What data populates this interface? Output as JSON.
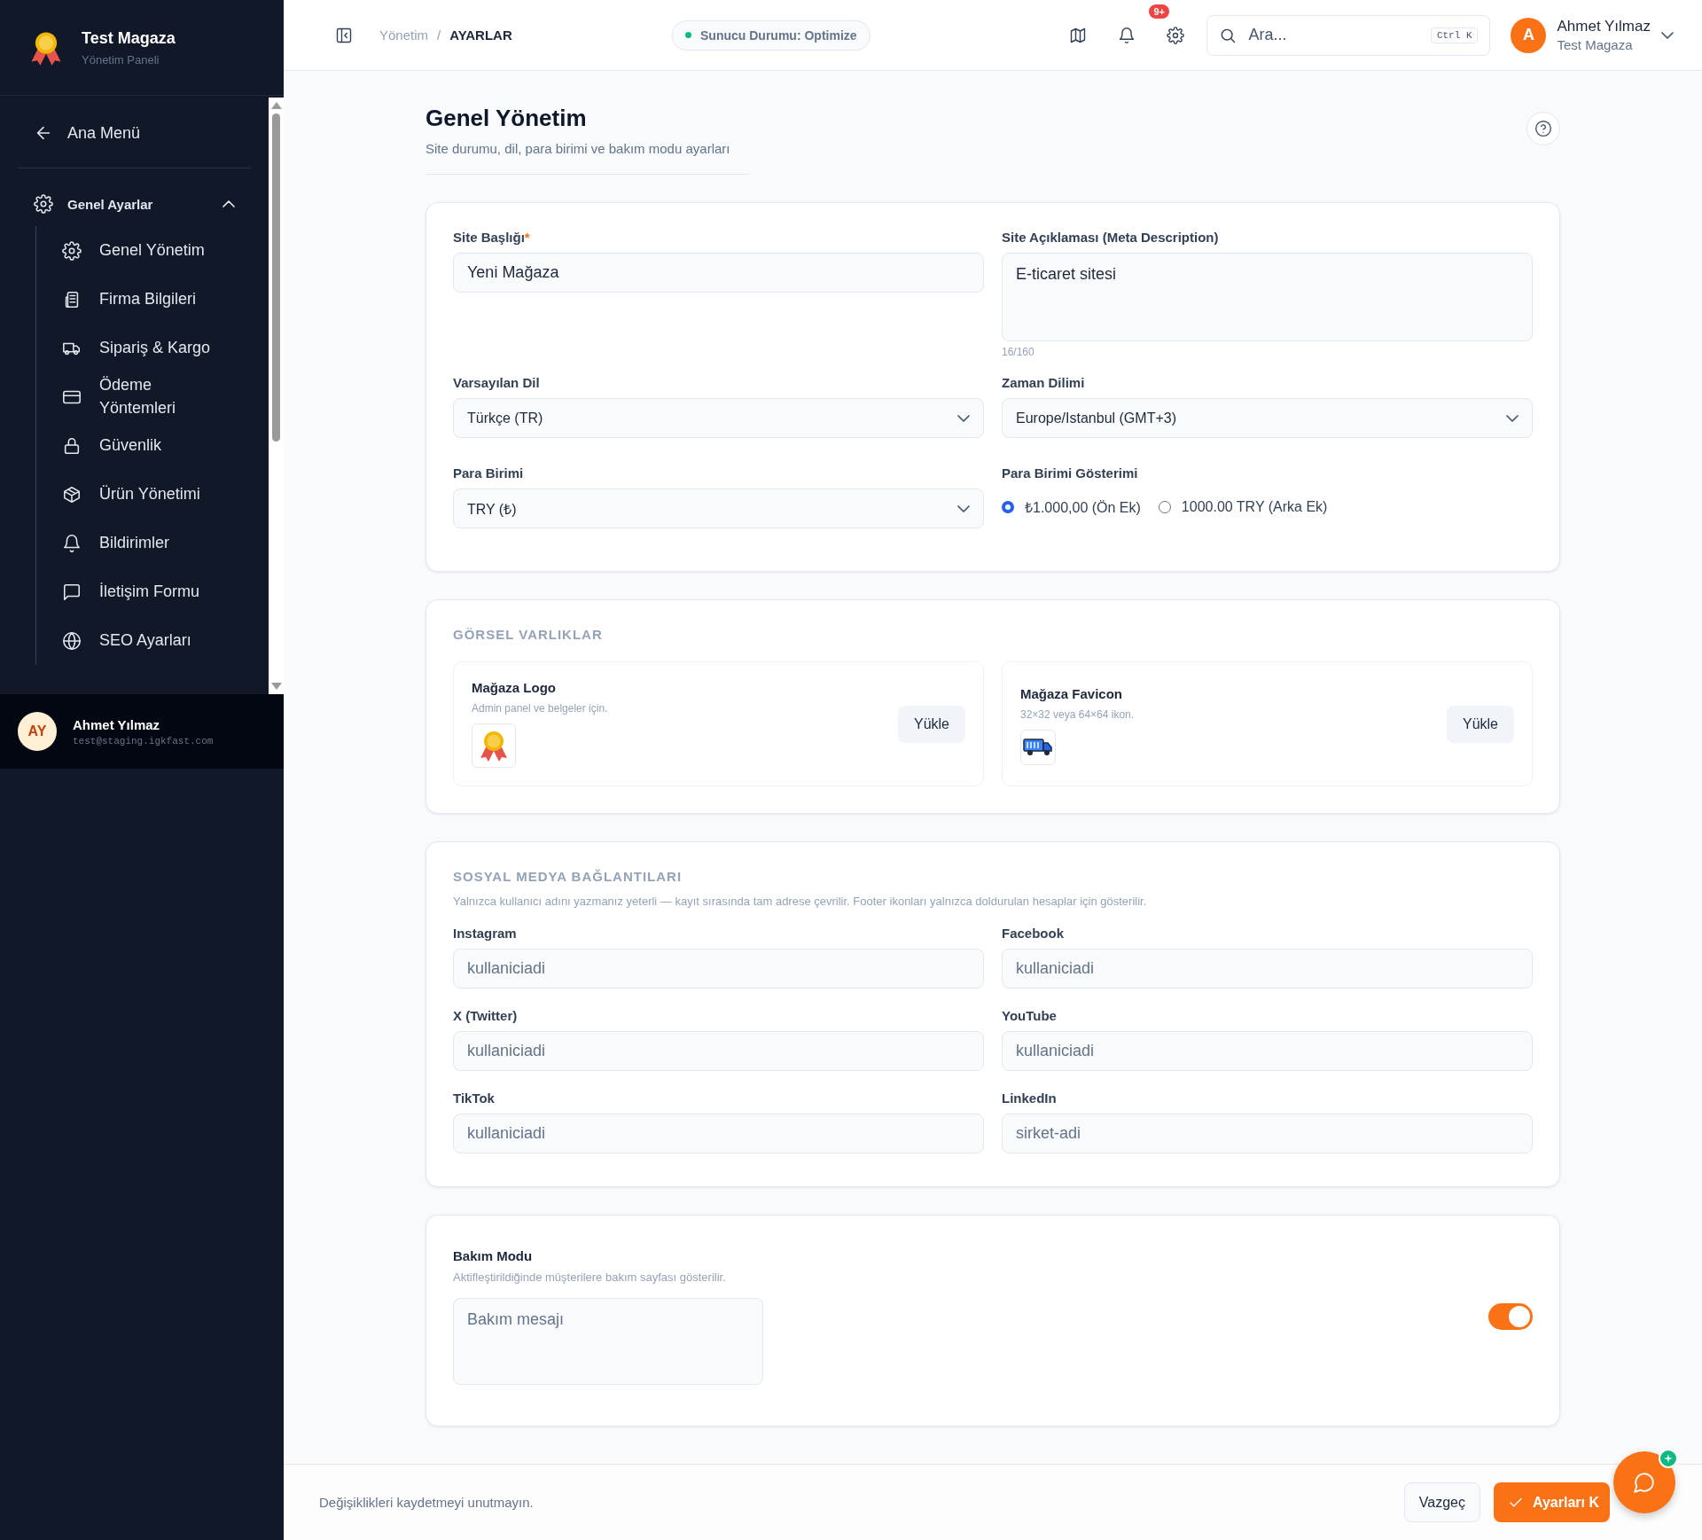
{
  "sidebar": {
    "brand": {
      "title": "Test Magaza",
      "subtitle": "Yönetim Paneli"
    },
    "back_link": "Ana Menü",
    "group": {
      "label": "Genel Ayarlar",
      "expanded": true,
      "children": [
        {
          "label": "Genel Yönetim",
          "selected": false
        },
        {
          "label": "Firma Bilgileri",
          "selected": false
        },
        {
          "label": "Sipariş & Kargo",
          "selected": false
        },
        {
          "label": "Ödeme Yöntemleri",
          "selected": false
        },
        {
          "label": "Güvenlik",
          "selected": false
        },
        {
          "label": "Ürün Yönetimi",
          "selected": false
        },
        {
          "label": "Bildirimler",
          "selected": false
        },
        {
          "label": "İletişim Formu",
          "selected": false
        },
        {
          "label": "SEO Ayarları",
          "selected": false
        }
      ]
    },
    "user": {
      "initials": "AY",
      "name": "Ahmet Yılmaz",
      "email": "test@staging.igkfast.com"
    }
  },
  "topbar": {
    "breadcrumb": {
      "items": [
        "Yönetim",
        "AYARLAR"
      ],
      "separator": "/"
    },
    "status": "Sunucu Durumu: Optimize",
    "notification_badge": "9+",
    "search": {
      "placeholder": "Ara...",
      "shortcut": "Ctrl K"
    },
    "user": {
      "initial": "A",
      "name": "Ahmet Yılmaz",
      "store": "Test Magaza"
    }
  },
  "page": {
    "title": "Genel Yönetim",
    "subtitle": "Site durumu, dil, para birimi ve bakım modu ayarları"
  },
  "general": {
    "site_title": {
      "label": "Site Başlığı",
      "required_mark": "*",
      "value": "Yeni Mağaza"
    },
    "site_description": {
      "label": "Site Açıklaması (Meta Description)",
      "value": "E-ticaret sitesi",
      "counter": "16/160"
    },
    "default_language": {
      "label": "Varsayılan Dil",
      "value": "Türkçe (TR)"
    },
    "timezone": {
      "label": "Zaman Dilimi",
      "value": "Europe/Istanbul (GMT+3)"
    },
    "currency": {
      "label": "Para Birimi",
      "value": "TRY (₺)"
    },
    "currency_display": {
      "label": "Para Birimi Gösterimi",
      "options": [
        {
          "label": "₺1.000,00 (Ön Ek)",
          "selected": true
        },
        {
          "label": "1000.00 TRY (Arka Ek)",
          "selected": false
        }
      ]
    }
  },
  "assets": {
    "heading": "GÖRSEL VARLIKLAR",
    "items": [
      {
        "title": "Mağaza Logo",
        "hint": "Admin panel ve belgeler için.",
        "button": "Yükle"
      },
      {
        "title": "Mağaza Favicon",
        "hint": "32×32 veya 64×64 ikon.",
        "button": "Yükle"
      }
    ]
  },
  "social": {
    "heading": "SOSYAL MEDYA BAĞLANTILARI",
    "note": "Yalnızca kullanıcı adını yazmanız yeterli — kayıt sırasında tam adrese çevrilir. Footer ikonları yalnızca doldurulan hesaplar için gösterilir.",
    "fields": [
      {
        "label": "Instagram",
        "placeholder": "kullaniciadi"
      },
      {
        "label": "Facebook",
        "placeholder": "kullaniciadi"
      },
      {
        "label": "X (Twitter)",
        "placeholder": "kullaniciadi"
      },
      {
        "label": "YouTube",
        "placeholder": "kullaniciadi"
      },
      {
        "label": "TikTok",
        "placeholder": "kullaniciadi"
      },
      {
        "label": "LinkedIn",
        "placeholder": "sirket-adi"
      }
    ]
  },
  "maintenance": {
    "title": "Bakım Modu",
    "description": "Aktifleştirildiğinde müşterilere bakım sayfası gösterilir.",
    "placeholder": "Bakım mesajı",
    "on": true
  },
  "footer": {
    "note": "Değişiklikleri kaydetmeyi unutmayın.",
    "cancel": "Vazgeç",
    "save": "Ayarları K"
  }
}
